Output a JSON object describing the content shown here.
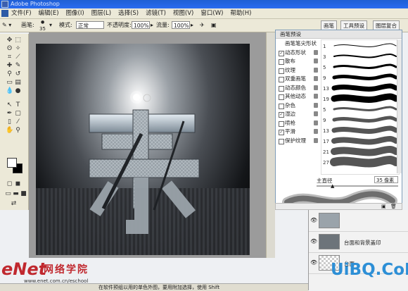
{
  "titlebar": {
    "app_title": "Adobe Photoshop"
  },
  "menu": {
    "items": [
      "文件(F)",
      "编辑(E)",
      "图像(I)",
      "图层(L)",
      "选择(S)",
      "滤镜(T)",
      "视图(V)",
      "窗口(W)",
      "帮助(H)"
    ]
  },
  "options": {
    "brush_label": "画笔:",
    "brush_size": "35",
    "mode_label": "模式:",
    "mode_value": "正常",
    "opacity_label": "不透明度:",
    "opacity_value": "100%",
    "flow_label": "流量:",
    "flow_value": "100%"
  },
  "right_tabs": [
    "画笔",
    "工具预设",
    "图层复合"
  ],
  "brush_panel": {
    "header": "画笔预设",
    "options": [
      {
        "label": "画笔笔尖形状",
        "checked": false,
        "lock": false,
        "selected": false
      },
      {
        "label": "动态形状",
        "checked": true,
        "lock": true,
        "selected": false
      },
      {
        "label": "散布",
        "checked": false,
        "lock": true,
        "selected": false
      },
      {
        "label": "纹理",
        "checked": false,
        "lock": true,
        "selected": false
      },
      {
        "label": "双重画笔",
        "checked": false,
        "lock": true,
        "selected": false
      },
      {
        "label": "动态颜色",
        "checked": false,
        "lock": true,
        "selected": false
      },
      {
        "label": "其他动态",
        "checked": false,
        "lock": true,
        "selected": false
      },
      {
        "label": "杂色",
        "checked": false,
        "lock": true,
        "selected": false
      },
      {
        "label": "湿边",
        "checked": true,
        "lock": true,
        "selected": false
      },
      {
        "label": "喷枪",
        "checked": false,
        "lock": true,
        "selected": false
      },
      {
        "label": "平滑",
        "checked": true,
        "lock": true,
        "selected": false
      },
      {
        "label": "保护纹理",
        "checked": false,
        "lock": true,
        "selected": false
      }
    ],
    "brush_sizes": [
      "1",
      "3",
      "5",
      "9",
      "13",
      "19",
      "5",
      "9",
      "13",
      "17",
      "21",
      "27"
    ],
    "master_label": "主直径",
    "master_value": "35 像素"
  },
  "layers": [
    {
      "name": "",
      "thumb": "text"
    },
    {
      "name": "台面和背景盖印",
      "thumb": "text"
    },
    {
      "name": "台面",
      "thumb": "checker"
    }
  ],
  "watermark": {
    "enet": "eNet",
    "site_cn": "网络学院",
    "url": "www.enet.com.cn/eschool",
    "status": "在软件预组以用的单色外图，要用附加选择，使用 Shift"
  },
  "uibq": "UiBQ.CoM"
}
